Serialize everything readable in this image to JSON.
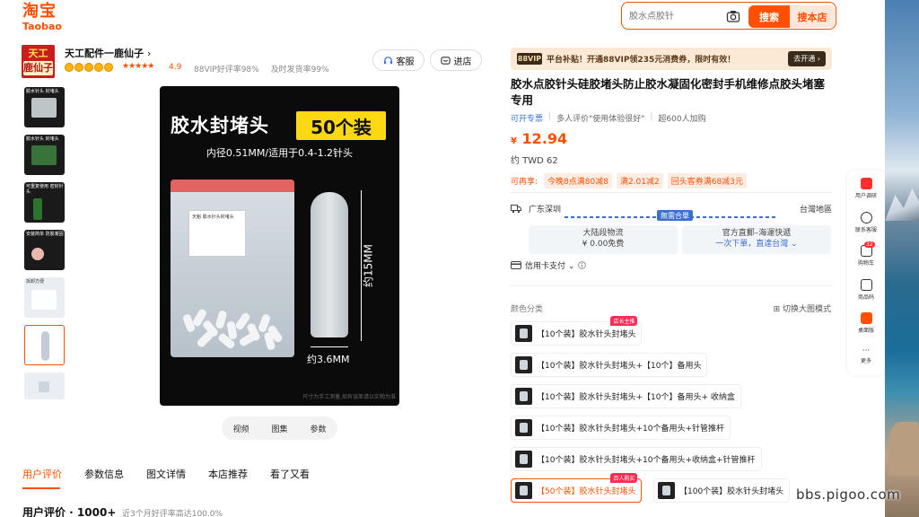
{
  "header": {
    "logo_cn": "淘宝",
    "logo_en": "Taobao",
    "search_placeholder": "胶水点胶针",
    "search_button": "搜索",
    "shop_search_button": "搜本店"
  },
  "shop": {
    "name": "天工配件一鹿仙子",
    "logo_line1": "天工",
    "logo_line2": "鹿仙子",
    "rating": "4.9",
    "stats": [
      "88VIP好评率98%",
      "及时发货率99%"
    ],
    "buttons": {
      "service": "客服",
      "enter": "进店"
    }
  },
  "gallery": {
    "thumbnails": [
      {
        "label": "胶水针头 封堵头",
        "style": "dark"
      },
      {
        "label": "胶水针头 封堵头",
        "style": "dark"
      },
      {
        "label": "可重复使用 密封针头",
        "style": "dark"
      },
      {
        "label": "安装简单 防胶凝固",
        "style": "dark"
      },
      {
        "label": "拆卸方便",
        "style": "light"
      },
      {
        "label": "",
        "style": "light"
      },
      {
        "label": "",
        "style": "light"
      }
    ],
    "main": {
      "title": "胶水封堵头",
      "badge": "50个装",
      "subtitle": "内径0.51MM/适用于0.4-1.2针头",
      "length_label": "约15MM",
      "width_label": "约3.6MM",
      "bag_label": "天魁 胶水针头封堵头",
      "note": "尺寸为手工测量,如有误差请以实物为准"
    },
    "view_tabs": [
      "视频",
      "图集",
      "参数"
    ]
  },
  "bottom_tabs": {
    "items": [
      "用户评价",
      "参数信息",
      "图文详情",
      "本店推荐",
      "看了又看"
    ],
    "active_index": 0,
    "review_title": "用户评价 · 1000+",
    "review_sub": "近3个月好评率高达100.0%"
  },
  "product": {
    "vip_badge": "88VIP",
    "vip_text": "平台补贴！开通88VIP领235元消费券，限时有效！",
    "vip_button": "去开通 ›",
    "title": "胶水点胶针头硅胶堵头防止胶水凝固化密封手机维修点胶头堵塞专用",
    "tags": [
      "可开专票",
      "多人评价\"使用体验很好\"",
      "超600人加购"
    ],
    "currency": "¥",
    "price": "12.94",
    "price_twd": "约 TWD 62",
    "coupon_label": "可再享:",
    "coupons": [
      "今晚8点满80减8",
      "满2.01减2",
      "回头客券满68减3元"
    ],
    "shipping": {
      "from": "广东深圳",
      "to": "台灣地區",
      "badge": "無需合單",
      "mainland_label": "大陆段物流",
      "mainland_price": "¥ 0.00免费",
      "official_label": "官方直郵–海運快遞",
      "official_link": "一次下單，直達台灣 ⌄"
    },
    "payment": "信用卡支付 ⌄",
    "color_label": "颜色分类",
    "switch_mode": "切换大图模式",
    "options": [
      {
        "label": "【10个装】胶水针头封堵头",
        "tag": "店长主推",
        "selected": false
      },
      {
        "label": "【10个装】胶水针头封堵头+【10个】备用头",
        "tag": "",
        "selected": false
      },
      {
        "label": "【10个装】胶水针头封堵头+【10个】备用头+ 收纳盒",
        "tag": "",
        "selected": false
      },
      {
        "label": "【10个装】胶水针头封堵头+10个备用头+针管推杆",
        "tag": "",
        "selected": false
      },
      {
        "label": "【10个装】胶水针头封堵头+10个备用头+收纳盒+针管推杆",
        "tag": "",
        "selected": false
      },
      {
        "label": "【50个装】胶水针头封堵头",
        "tag": "百人购买",
        "selected": true
      },
      {
        "label": "【100个装】胶水针头封堵头",
        "tag": "",
        "selected": false
      }
    ]
  },
  "sidebar": {
    "items": [
      {
        "label": "用户调研",
        "icon": "survey-icon"
      },
      {
        "label": "联系客服",
        "icon": "service-icon"
      },
      {
        "label": "购物车",
        "icon": "cart-icon",
        "badge": "32"
      },
      {
        "label": "商品码",
        "icon": "qrcode-icon"
      },
      {
        "label": "桌面版",
        "icon": "desktop-icon"
      },
      {
        "label": "更多",
        "icon": "more-icon"
      }
    ]
  },
  "watermark": "bbs.pigoo.com",
  "colors": {
    "accent": "#ff5000",
    "link": "#3b6fd3"
  }
}
